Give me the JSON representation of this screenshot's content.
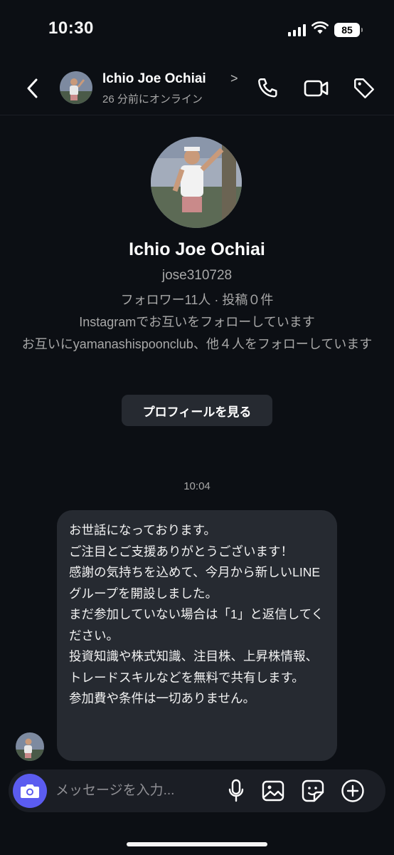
{
  "status_bar": {
    "time": "10:30",
    "battery": "85"
  },
  "header": {
    "name": "Ichio Joe Ochiai",
    "chevron": ">",
    "status": "26 分前にオンライン"
  },
  "profile": {
    "name": "Ichio Joe Ochiai",
    "username": "jose310728",
    "stats": "フォロワー11人 · 投稿０件",
    "mutual_follow": "Instagramでお互いをフォローしています",
    "mutual_friends": "お互いにyamanashispoonclub、他４人をフォローしています",
    "view_profile_label": "プロフィールを見る"
  },
  "conversation": {
    "timestamp": "10:04",
    "message": "お世話になっております。\nご注目とご支援ありがとうございます！\n感謝の気持ちを込めて、今月から新しいLINEグループを開設しました。\nまだ参加していない場合は「1」と返信してください。\n投資知識や株式知識、注目株、上昇株情報、トレードスキルなどを無料で共有します。\n参加費や条件は一切ありません。"
  },
  "composer": {
    "placeholder": "メッセージを入力..."
  },
  "icons": [
    "signal-icon",
    "wifi-icon",
    "back-chevron-icon",
    "phone-icon",
    "video-camera-icon",
    "tag-icon",
    "camera-icon",
    "microphone-icon",
    "gallery-icon",
    "sticker-icon",
    "plus-icon"
  ],
  "colors": {
    "background": "#0c0f14",
    "bubble": "#262a31",
    "accent": "#5b5cf0",
    "secondary_text": "#a8a8a8"
  }
}
